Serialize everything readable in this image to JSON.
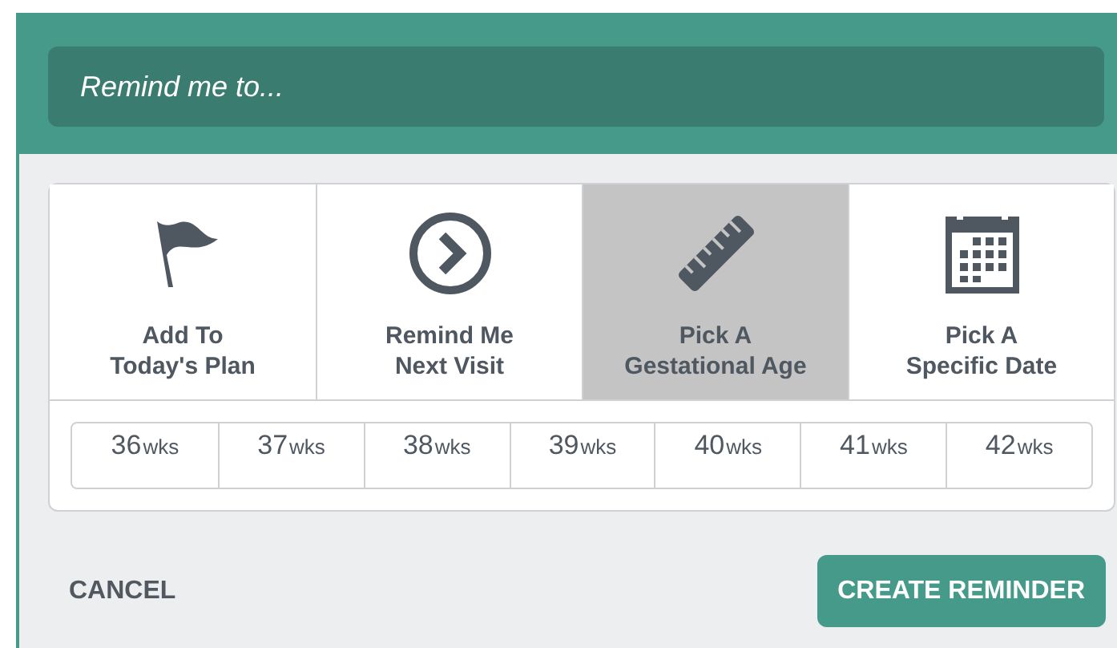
{
  "reminder_field": {
    "placeholder": "Remind me to..."
  },
  "options": [
    {
      "kind": "flag",
      "label_line_1": "Add To",
      "label_line_2": "Today's Plan",
      "selected": false
    },
    {
      "kind": "next",
      "label_line_1": "Remind Me",
      "label_line_2": "Next Visit",
      "selected": false
    },
    {
      "kind": "ruler",
      "label_line_1": "Pick A",
      "label_line_2": "Gestational Age",
      "selected": true
    },
    {
      "kind": "calendar",
      "label_line_1": "Pick A",
      "label_line_2": "Specific Date",
      "selected": false
    }
  ],
  "weeks": [
    {
      "number": "36",
      "unit": "wks"
    },
    {
      "number": "37",
      "unit": "wks"
    },
    {
      "number": "38",
      "unit": "wks"
    },
    {
      "number": "39",
      "unit": "wks"
    },
    {
      "number": "40",
      "unit": "wks"
    },
    {
      "number": "41",
      "unit": "wks"
    },
    {
      "number": "42",
      "unit": "wks"
    }
  ],
  "buttons": {
    "cancel": "CANCEL",
    "create": "CREATE REMINDER"
  }
}
